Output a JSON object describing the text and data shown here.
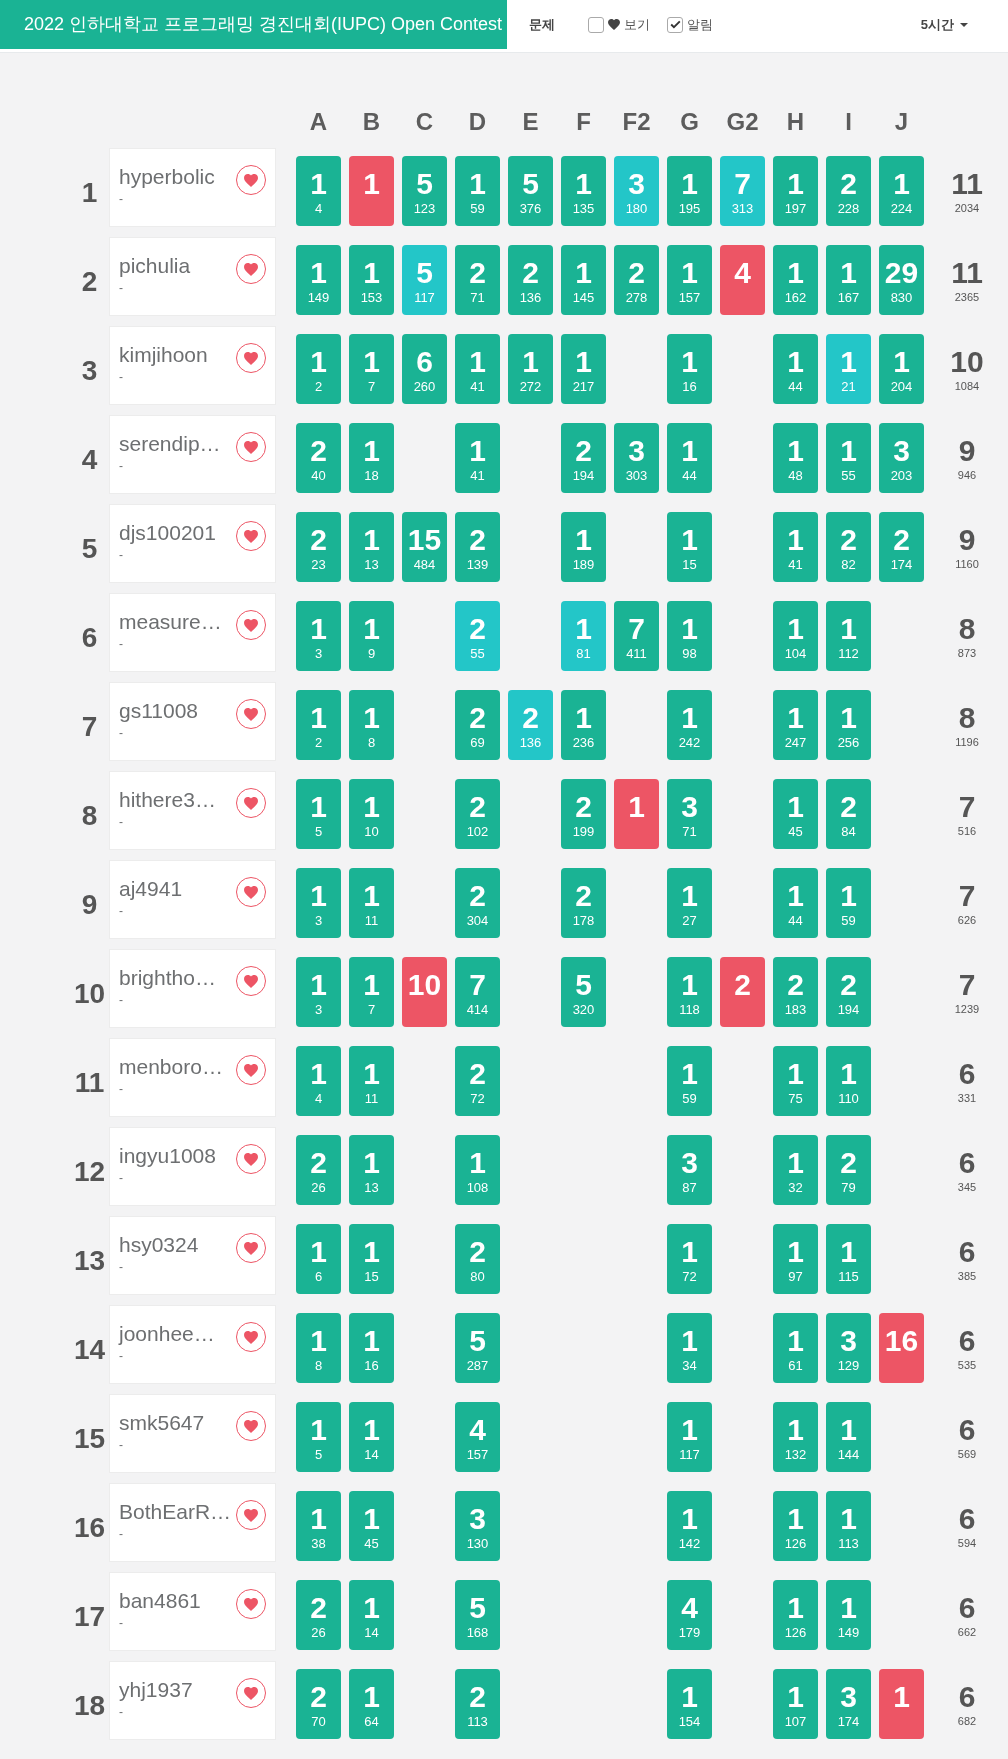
{
  "header": {
    "title": "2022 인하대학교 프로그래밍 경진대회(IUPC) Open Contest",
    "menu": "문제",
    "toggles": [
      {
        "kind": "iconed",
        "label": "보기",
        "checked": false
      },
      {
        "kind": "plain",
        "label": "알림",
        "checked": true
      }
    ],
    "dropdown": "5시간"
  },
  "columns": [
    "A",
    "B",
    "C",
    "D",
    "E",
    "F",
    "F2",
    "G",
    "G2",
    "H",
    "I",
    "J"
  ],
  "rows": [
    {
      "rank": "1",
      "name": "hyperbolic",
      "affiliation": "-",
      "cells": [
        {
          "kind": "solved",
          "tries": "1",
          "time": "4"
        },
        {
          "kind": "failed",
          "tries": "1"
        },
        {
          "kind": "solved",
          "tries": "5",
          "time": "123"
        },
        {
          "kind": "solved",
          "tries": "1",
          "time": "59"
        },
        {
          "kind": "solved",
          "tries": "5",
          "time": "376"
        },
        {
          "kind": "solved",
          "tries": "1",
          "time": "135"
        },
        {
          "kind": "first",
          "tries": "3",
          "time": "180"
        },
        {
          "kind": "solved",
          "tries": "1",
          "time": "195"
        },
        {
          "kind": "first",
          "tries": "7",
          "time": "313"
        },
        {
          "kind": "solved",
          "tries": "1",
          "time": "197"
        },
        {
          "kind": "solved",
          "tries": "2",
          "time": "228"
        },
        {
          "kind": "solved",
          "tries": "1",
          "time": "224"
        }
      ],
      "solved": "11",
      "penalty": "2034"
    },
    {
      "rank": "2",
      "name": "pichulia",
      "affiliation": "-",
      "cells": [
        {
          "kind": "solved",
          "tries": "1",
          "time": "149"
        },
        {
          "kind": "solved",
          "tries": "1",
          "time": "153"
        },
        {
          "kind": "first",
          "tries": "5",
          "time": "117"
        },
        {
          "kind": "solved",
          "tries": "2",
          "time": "71"
        },
        {
          "kind": "solved",
          "tries": "2",
          "time": "136"
        },
        {
          "kind": "solved",
          "tries": "1",
          "time": "145"
        },
        {
          "kind": "solved",
          "tries": "2",
          "time": "278"
        },
        {
          "kind": "solved",
          "tries": "1",
          "time": "157"
        },
        {
          "kind": "failed",
          "tries": "4"
        },
        {
          "kind": "solved",
          "tries": "1",
          "time": "162"
        },
        {
          "kind": "solved",
          "tries": "1",
          "time": "167"
        },
        {
          "kind": "solved",
          "tries": "29",
          "time": "830"
        }
      ],
      "solved": "11",
      "penalty": "2365"
    },
    {
      "rank": "3",
      "name": "kimjihoon",
      "affiliation": "-",
      "cells": [
        {
          "kind": "solved",
          "tries": "1",
          "time": "2"
        },
        {
          "kind": "solved",
          "tries": "1",
          "time": "7"
        },
        {
          "kind": "solved",
          "tries": "6",
          "time": "260"
        },
        {
          "kind": "solved",
          "tries": "1",
          "time": "41"
        },
        {
          "kind": "solved",
          "tries": "1",
          "time": "272"
        },
        {
          "kind": "solved",
          "tries": "1",
          "time": "217"
        },
        null,
        {
          "kind": "solved",
          "tries": "1",
          "time": "16"
        },
        null,
        {
          "kind": "solved",
          "tries": "1",
          "time": "44"
        },
        {
          "kind": "first",
          "tries": "1",
          "time": "21"
        },
        {
          "kind": "solved",
          "tries": "1",
          "time": "204"
        }
      ],
      "solved": "10",
      "penalty": "1084"
    },
    {
      "rank": "4",
      "name": "serendip…",
      "affiliation": "-",
      "cells": [
        {
          "kind": "solved",
          "tries": "2",
          "time": "40"
        },
        {
          "kind": "solved",
          "tries": "1",
          "time": "18"
        },
        null,
        {
          "kind": "solved",
          "tries": "1",
          "time": "41"
        },
        null,
        {
          "kind": "solved",
          "tries": "2",
          "time": "194"
        },
        {
          "kind": "solved",
          "tries": "3",
          "time": "303"
        },
        {
          "kind": "solved",
          "tries": "1",
          "time": "44"
        },
        null,
        {
          "kind": "solved",
          "tries": "1",
          "time": "48"
        },
        {
          "kind": "solved",
          "tries": "1",
          "time": "55"
        },
        {
          "kind": "solved",
          "tries": "3",
          "time": "203"
        }
      ],
      "solved": "9",
      "penalty": "946"
    },
    {
      "rank": "5",
      "name": "djs100201",
      "affiliation": "-",
      "cells": [
        {
          "kind": "solved",
          "tries": "2",
          "time": "23"
        },
        {
          "kind": "solved",
          "tries": "1",
          "time": "13"
        },
        {
          "kind": "solved",
          "tries": "15",
          "time": "484"
        },
        {
          "kind": "solved",
          "tries": "2",
          "time": "139"
        },
        null,
        {
          "kind": "solved",
          "tries": "1",
          "time": "189"
        },
        null,
        {
          "kind": "solved",
          "tries": "1",
          "time": "15"
        },
        null,
        {
          "kind": "solved",
          "tries": "1",
          "time": "41"
        },
        {
          "kind": "solved",
          "tries": "2",
          "time": "82"
        },
        {
          "kind": "solved",
          "tries": "2",
          "time": "174"
        }
      ],
      "solved": "9",
      "penalty": "1160"
    },
    {
      "rank": "6",
      "name": "measure…",
      "affiliation": "-",
      "cells": [
        {
          "kind": "solved",
          "tries": "1",
          "time": "3"
        },
        {
          "kind": "solved",
          "tries": "1",
          "time": "9"
        },
        null,
        {
          "kind": "first",
          "tries": "2",
          "time": "55"
        },
        null,
        {
          "kind": "first",
          "tries": "1",
          "time": "81"
        },
        {
          "kind": "solved",
          "tries": "7",
          "time": "411"
        },
        {
          "kind": "solved",
          "tries": "1",
          "time": "98"
        },
        null,
        {
          "kind": "solved",
          "tries": "1",
          "time": "104"
        },
        {
          "kind": "solved",
          "tries": "1",
          "time": "112"
        },
        null
      ],
      "solved": "8",
      "penalty": "873"
    },
    {
      "rank": "7",
      "name": "gs11008",
      "affiliation": "-",
      "cells": [
        {
          "kind": "solved",
          "tries": "1",
          "time": "2"
        },
        {
          "kind": "solved",
          "tries": "1",
          "time": "8"
        },
        null,
        {
          "kind": "solved",
          "tries": "2",
          "time": "69"
        },
        {
          "kind": "first",
          "tries": "2",
          "time": "136"
        },
        {
          "kind": "solved",
          "tries": "1",
          "time": "236"
        },
        null,
        {
          "kind": "solved",
          "tries": "1",
          "time": "242"
        },
        null,
        {
          "kind": "solved",
          "tries": "1",
          "time": "247"
        },
        {
          "kind": "solved",
          "tries": "1",
          "time": "256"
        },
        null
      ],
      "solved": "8",
      "penalty": "1196"
    },
    {
      "rank": "8",
      "name": "hithere3…",
      "affiliation": "-",
      "cells": [
        {
          "kind": "solved",
          "tries": "1",
          "time": "5"
        },
        {
          "kind": "solved",
          "tries": "1",
          "time": "10"
        },
        null,
        {
          "kind": "solved",
          "tries": "2",
          "time": "102"
        },
        null,
        {
          "kind": "solved",
          "tries": "2",
          "time": "199"
        },
        {
          "kind": "failed",
          "tries": "1"
        },
        {
          "kind": "solved",
          "tries": "3",
          "time": "71"
        },
        null,
        {
          "kind": "solved",
          "tries": "1",
          "time": "45"
        },
        {
          "kind": "solved",
          "tries": "2",
          "time": "84"
        },
        null
      ],
      "solved": "7",
      "penalty": "516"
    },
    {
      "rank": "9",
      "name": "aj4941",
      "affiliation": "-",
      "cells": [
        {
          "kind": "solved",
          "tries": "1",
          "time": "3"
        },
        {
          "kind": "solved",
          "tries": "1",
          "time": "11"
        },
        null,
        {
          "kind": "solved",
          "tries": "2",
          "time": "304"
        },
        null,
        {
          "kind": "solved",
          "tries": "2",
          "time": "178"
        },
        null,
        {
          "kind": "solved",
          "tries": "1",
          "time": "27"
        },
        null,
        {
          "kind": "solved",
          "tries": "1",
          "time": "44"
        },
        {
          "kind": "solved",
          "tries": "1",
          "time": "59"
        },
        null
      ],
      "solved": "7",
      "penalty": "626"
    },
    {
      "rank": "10",
      "name": "brightho…",
      "affiliation": "-",
      "cells": [
        {
          "kind": "solved",
          "tries": "1",
          "time": "3"
        },
        {
          "kind": "solved",
          "tries": "1",
          "time": "7"
        },
        {
          "kind": "failed",
          "tries": "10"
        },
        {
          "kind": "solved",
          "tries": "7",
          "time": "414"
        },
        null,
        {
          "kind": "solved",
          "tries": "5",
          "time": "320"
        },
        null,
        {
          "kind": "solved",
          "tries": "1",
          "time": "118"
        },
        {
          "kind": "failed",
          "tries": "2"
        },
        {
          "kind": "solved",
          "tries": "2",
          "time": "183"
        },
        {
          "kind": "solved",
          "tries": "2",
          "time": "194"
        },
        null
      ],
      "solved": "7",
      "penalty": "1239"
    },
    {
      "rank": "11",
      "name": "menboro…",
      "affiliation": "-",
      "cells": [
        {
          "kind": "solved",
          "tries": "1",
          "time": "4"
        },
        {
          "kind": "solved",
          "tries": "1",
          "time": "11"
        },
        null,
        {
          "kind": "solved",
          "tries": "2",
          "time": "72"
        },
        null,
        null,
        null,
        {
          "kind": "solved",
          "tries": "1",
          "time": "59"
        },
        null,
        {
          "kind": "solved",
          "tries": "1",
          "time": "75"
        },
        {
          "kind": "solved",
          "tries": "1",
          "time": "110"
        },
        null
      ],
      "solved": "6",
      "penalty": "331"
    },
    {
      "rank": "12",
      "name": "ingyu1008",
      "affiliation": "-",
      "cells": [
        {
          "kind": "solved",
          "tries": "2",
          "time": "26"
        },
        {
          "kind": "solved",
          "tries": "1",
          "time": "13"
        },
        null,
        {
          "kind": "solved",
          "tries": "1",
          "time": "108"
        },
        null,
        null,
        null,
        {
          "kind": "solved",
          "tries": "3",
          "time": "87"
        },
        null,
        {
          "kind": "solved",
          "tries": "1",
          "time": "32"
        },
        {
          "kind": "solved",
          "tries": "2",
          "time": "79"
        },
        null
      ],
      "solved": "6",
      "penalty": "345"
    },
    {
      "rank": "13",
      "name": "hsy0324",
      "affiliation": "-",
      "cells": [
        {
          "kind": "solved",
          "tries": "1",
          "time": "6"
        },
        {
          "kind": "solved",
          "tries": "1",
          "time": "15"
        },
        null,
        {
          "kind": "solved",
          "tries": "2",
          "time": "80"
        },
        null,
        null,
        null,
        {
          "kind": "solved",
          "tries": "1",
          "time": "72"
        },
        null,
        {
          "kind": "solved",
          "tries": "1",
          "time": "97"
        },
        {
          "kind": "solved",
          "tries": "1",
          "time": "115"
        },
        null
      ],
      "solved": "6",
      "penalty": "385"
    },
    {
      "rank": "14",
      "name": "joonhee…",
      "affiliation": "-",
      "cells": [
        {
          "kind": "solved",
          "tries": "1",
          "time": "8"
        },
        {
          "kind": "solved",
          "tries": "1",
          "time": "16"
        },
        null,
        {
          "kind": "solved",
          "tries": "5",
          "time": "287"
        },
        null,
        null,
        null,
        {
          "kind": "solved",
          "tries": "1",
          "time": "34"
        },
        null,
        {
          "kind": "solved",
          "tries": "1",
          "time": "61"
        },
        {
          "kind": "solved",
          "tries": "3",
          "time": "129"
        },
        {
          "kind": "failed",
          "tries": "16"
        }
      ],
      "solved": "6",
      "penalty": "535"
    },
    {
      "rank": "15",
      "name": "smk5647",
      "affiliation": "-",
      "cells": [
        {
          "kind": "solved",
          "tries": "1",
          "time": "5"
        },
        {
          "kind": "solved",
          "tries": "1",
          "time": "14"
        },
        null,
        {
          "kind": "solved",
          "tries": "4",
          "time": "157"
        },
        null,
        null,
        null,
        {
          "kind": "solved",
          "tries": "1",
          "time": "117"
        },
        null,
        {
          "kind": "solved",
          "tries": "1",
          "time": "132"
        },
        {
          "kind": "solved",
          "tries": "1",
          "time": "144"
        },
        null
      ],
      "solved": "6",
      "penalty": "569"
    },
    {
      "rank": "16",
      "name": "BothEarR…",
      "affiliation": "-",
      "cells": [
        {
          "kind": "solved",
          "tries": "1",
          "time": "38"
        },
        {
          "kind": "solved",
          "tries": "1",
          "time": "45"
        },
        null,
        {
          "kind": "solved",
          "tries": "3",
          "time": "130"
        },
        null,
        null,
        null,
        {
          "kind": "solved",
          "tries": "1",
          "time": "142"
        },
        null,
        {
          "kind": "solved",
          "tries": "1",
          "time": "126"
        },
        {
          "kind": "solved",
          "tries": "1",
          "time": "113"
        },
        null
      ],
      "solved": "6",
      "penalty": "594"
    },
    {
      "rank": "17",
      "name": "ban4861",
      "affiliation": "-",
      "cells": [
        {
          "kind": "solved",
          "tries": "2",
          "time": "26"
        },
        {
          "kind": "solved",
          "tries": "1",
          "time": "14"
        },
        null,
        {
          "kind": "solved",
          "tries": "5",
          "time": "168"
        },
        null,
        null,
        null,
        {
          "kind": "solved",
          "tries": "4",
          "time": "179"
        },
        null,
        {
          "kind": "solved",
          "tries": "1",
          "time": "126"
        },
        {
          "kind": "solved",
          "tries": "1",
          "time": "149"
        },
        null
      ],
      "solved": "6",
      "penalty": "662"
    },
    {
      "rank": "18",
      "name": "yhj1937",
      "affiliation": "-",
      "cells": [
        {
          "kind": "solved",
          "tries": "2",
          "time": "70"
        },
        {
          "kind": "solved",
          "tries": "1",
          "time": "64"
        },
        null,
        {
          "kind": "solved",
          "tries": "2",
          "time": "113"
        },
        null,
        null,
        null,
        {
          "kind": "solved",
          "tries": "1",
          "time": "154"
        },
        null,
        {
          "kind": "solved",
          "tries": "1",
          "time": "107"
        },
        {
          "kind": "solved",
          "tries": "3",
          "time": "174"
        },
        {
          "kind": "failed",
          "tries": "1"
        }
      ],
      "solved": "6",
      "penalty": "682"
    }
  ]
}
